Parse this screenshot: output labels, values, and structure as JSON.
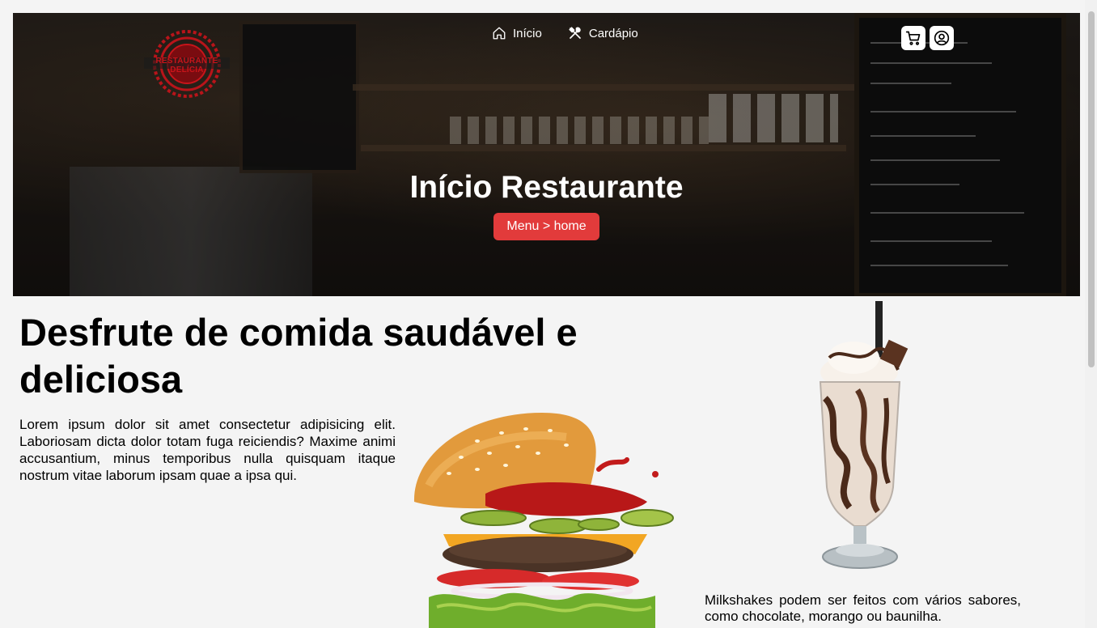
{
  "header": {
    "logo_text": "RESTAURANTE DELÍCIA",
    "nav": [
      {
        "label": "Início",
        "icon": "home-icon"
      },
      {
        "label": "Cardápio",
        "icon": "utensils-icon"
      }
    ],
    "actions": [
      {
        "icon": "cart-icon"
      },
      {
        "icon": "user-icon"
      }
    ]
  },
  "hero": {
    "title_bold": "Início",
    "title_rest": " Restaurante",
    "badge": "Menu > home"
  },
  "main": {
    "title": "Desfrute de comida saudável e deliciosa",
    "text": "Lorem ipsum dolor sit amet consectetur adipisicing elit. Laboriosam dicta dolor totam fuga reiciendis? Maxime animi accusantium, minus temporibus nulla quisquam itaque nostrum vitae laborum ipsam quae a ipsa qui.",
    "shake_text": "Milkshakes podem ser feitos com vários sabores, como chocolate, morango ou baunilha."
  },
  "colors": {
    "accent": "#e23b3b",
    "logo_red": "#c8141a",
    "background": "#f4f4f4"
  }
}
